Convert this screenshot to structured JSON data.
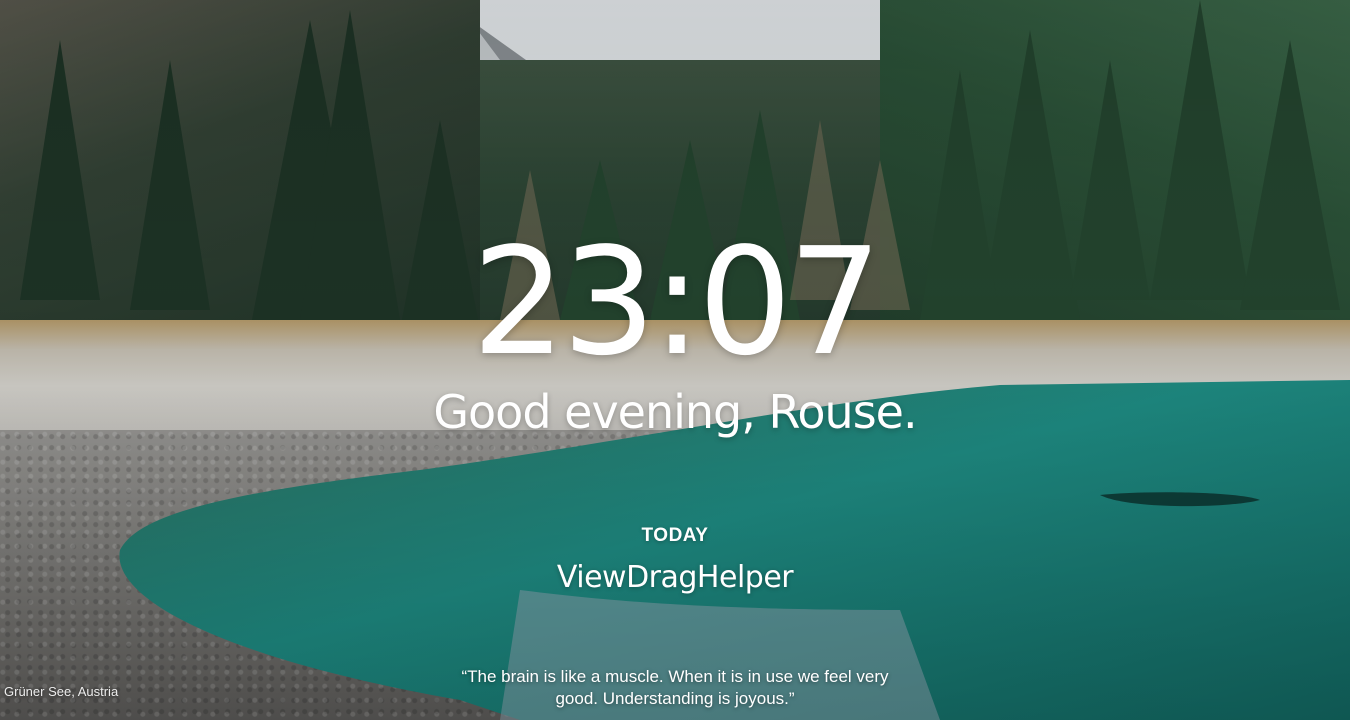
{
  "clock": {
    "time": "23:07"
  },
  "greeting": {
    "text": "Good evening, Rouse."
  },
  "focus": {
    "title": "TODAY",
    "item": "ViewDragHelper"
  },
  "quote": {
    "text": "“The brain is like a muscle. When it is in use we feel very good. Understanding is joyous.”"
  },
  "background": {
    "location": "Grüner See, Austria",
    "colors": {
      "water": "#1f8f86",
      "forest": "#2b4a36",
      "sky": "#e4e9ec",
      "gravel": "#7d7c79"
    }
  }
}
